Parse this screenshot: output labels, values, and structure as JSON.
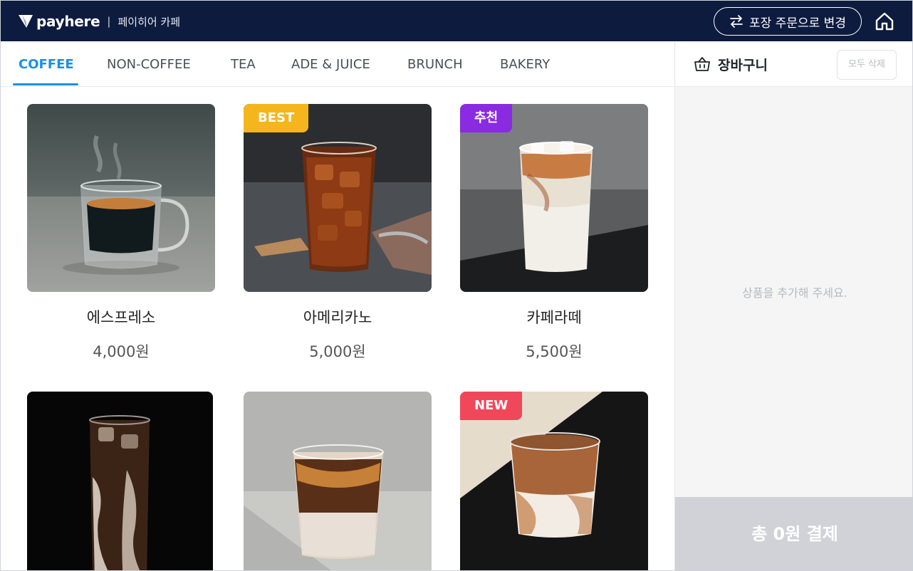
{
  "header": {
    "brand": "payhere",
    "separator": "|",
    "store_name": "페이히어 카페",
    "switch_label": "포장 주문으로 변경"
  },
  "tabs": [
    {
      "label": "COFFEE",
      "active": true
    },
    {
      "label": "NON-COFFEE",
      "active": false
    },
    {
      "label": "TEA",
      "active": false
    },
    {
      "label": "ADE & JUICE",
      "active": false
    },
    {
      "label": "BRUNCH",
      "active": false
    },
    {
      "label": "BAKERY",
      "active": false
    }
  ],
  "products": [
    {
      "name": "에스프레소",
      "price": "4,000원",
      "badge": ""
    },
    {
      "name": "아메리카노",
      "price": "5,000원",
      "badge": "BEST"
    },
    {
      "name": "카페라떼",
      "price": "5,500원",
      "badge": "추천"
    },
    {
      "name": "",
      "price": "",
      "badge": ""
    },
    {
      "name": "",
      "price": "",
      "badge": ""
    },
    {
      "name": "",
      "price": "",
      "badge": "NEW"
    }
  ],
  "badge_colors": {
    "BEST": "#f5b51d",
    "추천": "#8a2be2",
    "NEW": "#f0475a"
  },
  "cart": {
    "title": "장바구니",
    "clear_label": "모두 삭제",
    "empty_message": "상품을 추가해 주세요.",
    "pay_label": "총 0원 결제"
  },
  "colors": {
    "header_bg": "#0d1b3f",
    "accent": "#1b8ee8",
    "pay_disabled": "#d0d2d7"
  }
}
